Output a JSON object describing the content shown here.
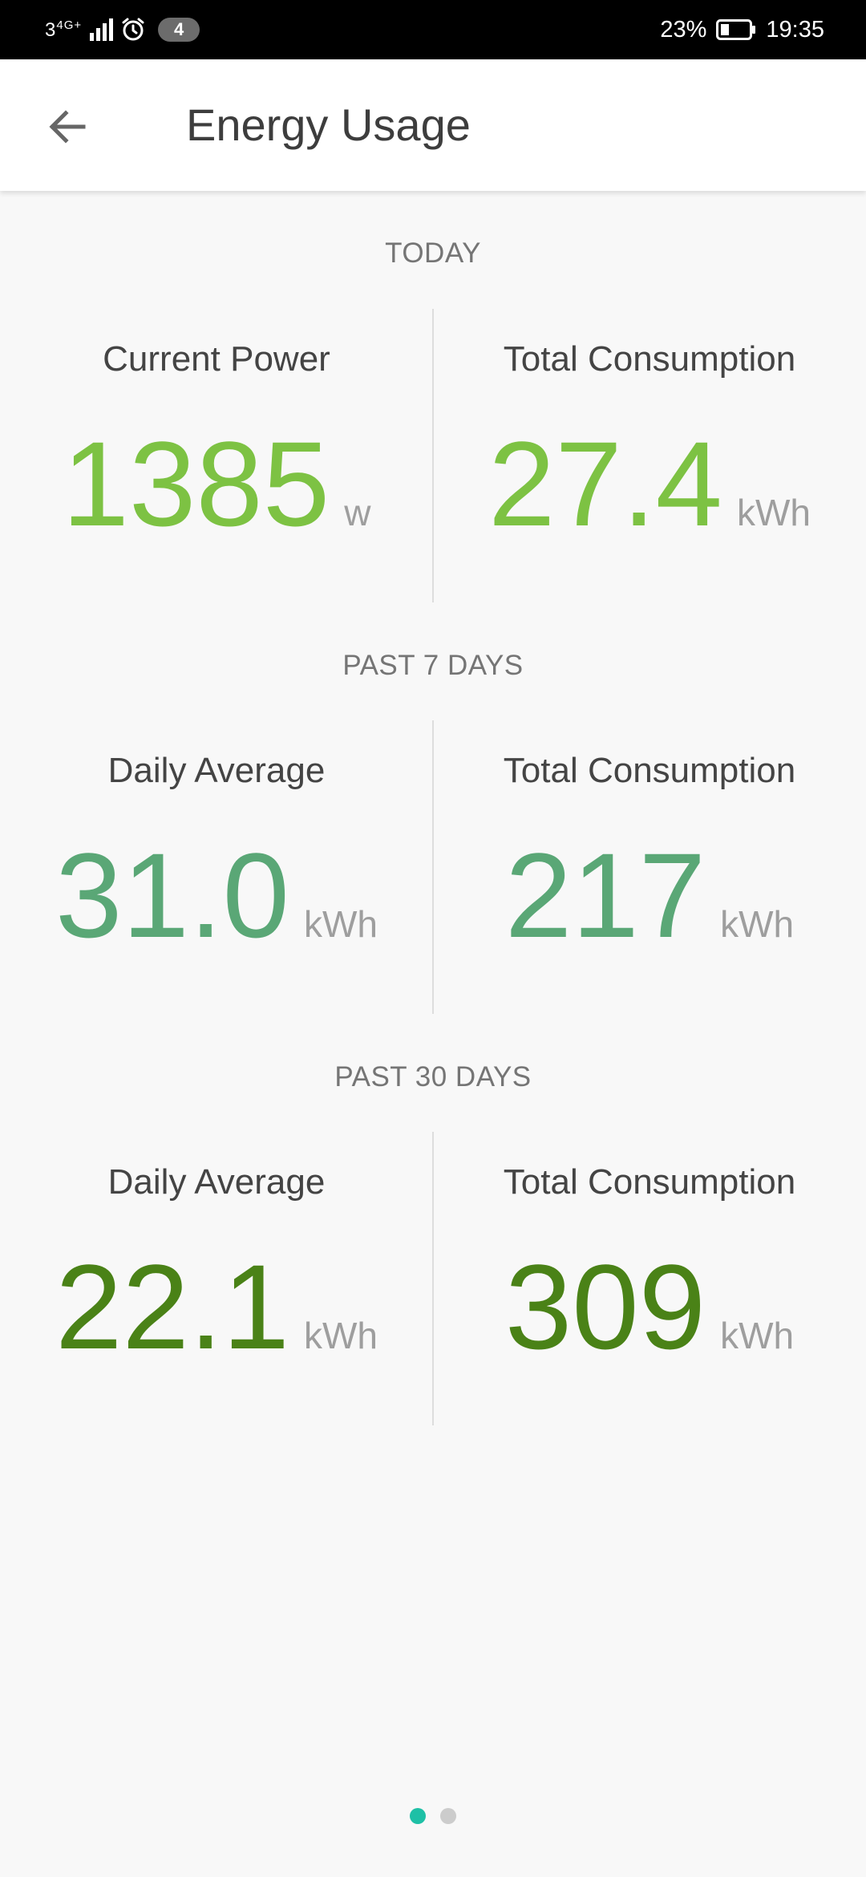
{
  "status_bar": {
    "net_type": "3",
    "net_gen": "4G+",
    "notifications_count": "4",
    "battery_percent": "23%",
    "time": "19:35"
  },
  "app_bar": {
    "title": "Energy Usage",
    "back_icon": "arrow-back-icon"
  },
  "sections": [
    {
      "label": "TODAY",
      "left": {
        "label": "Current Power",
        "value": "1385",
        "unit": "w"
      },
      "right": {
        "label": "Total Consumption",
        "value": "27.4",
        "unit": "kWh"
      },
      "color": "#7dc243"
    },
    {
      "label": "PAST 7 DAYS",
      "left": {
        "label": "Daily Average",
        "value": "31.0",
        "unit": "kWh"
      },
      "right": {
        "label": "Total Consumption",
        "value": "217",
        "unit": "kWh"
      },
      "color": "#5aa776"
    },
    {
      "label": "PAST 30 DAYS",
      "left": {
        "label": "Daily Average",
        "value": "22.1",
        "unit": "kWh"
      },
      "right": {
        "label": "Total Consumption",
        "value": "309",
        "unit": "kWh"
      },
      "color": "#4a8217"
    }
  ],
  "page_indicator": {
    "total": 2,
    "active": 0,
    "active_color": "#1ec0a6",
    "inactive_color": "#cccccc"
  }
}
